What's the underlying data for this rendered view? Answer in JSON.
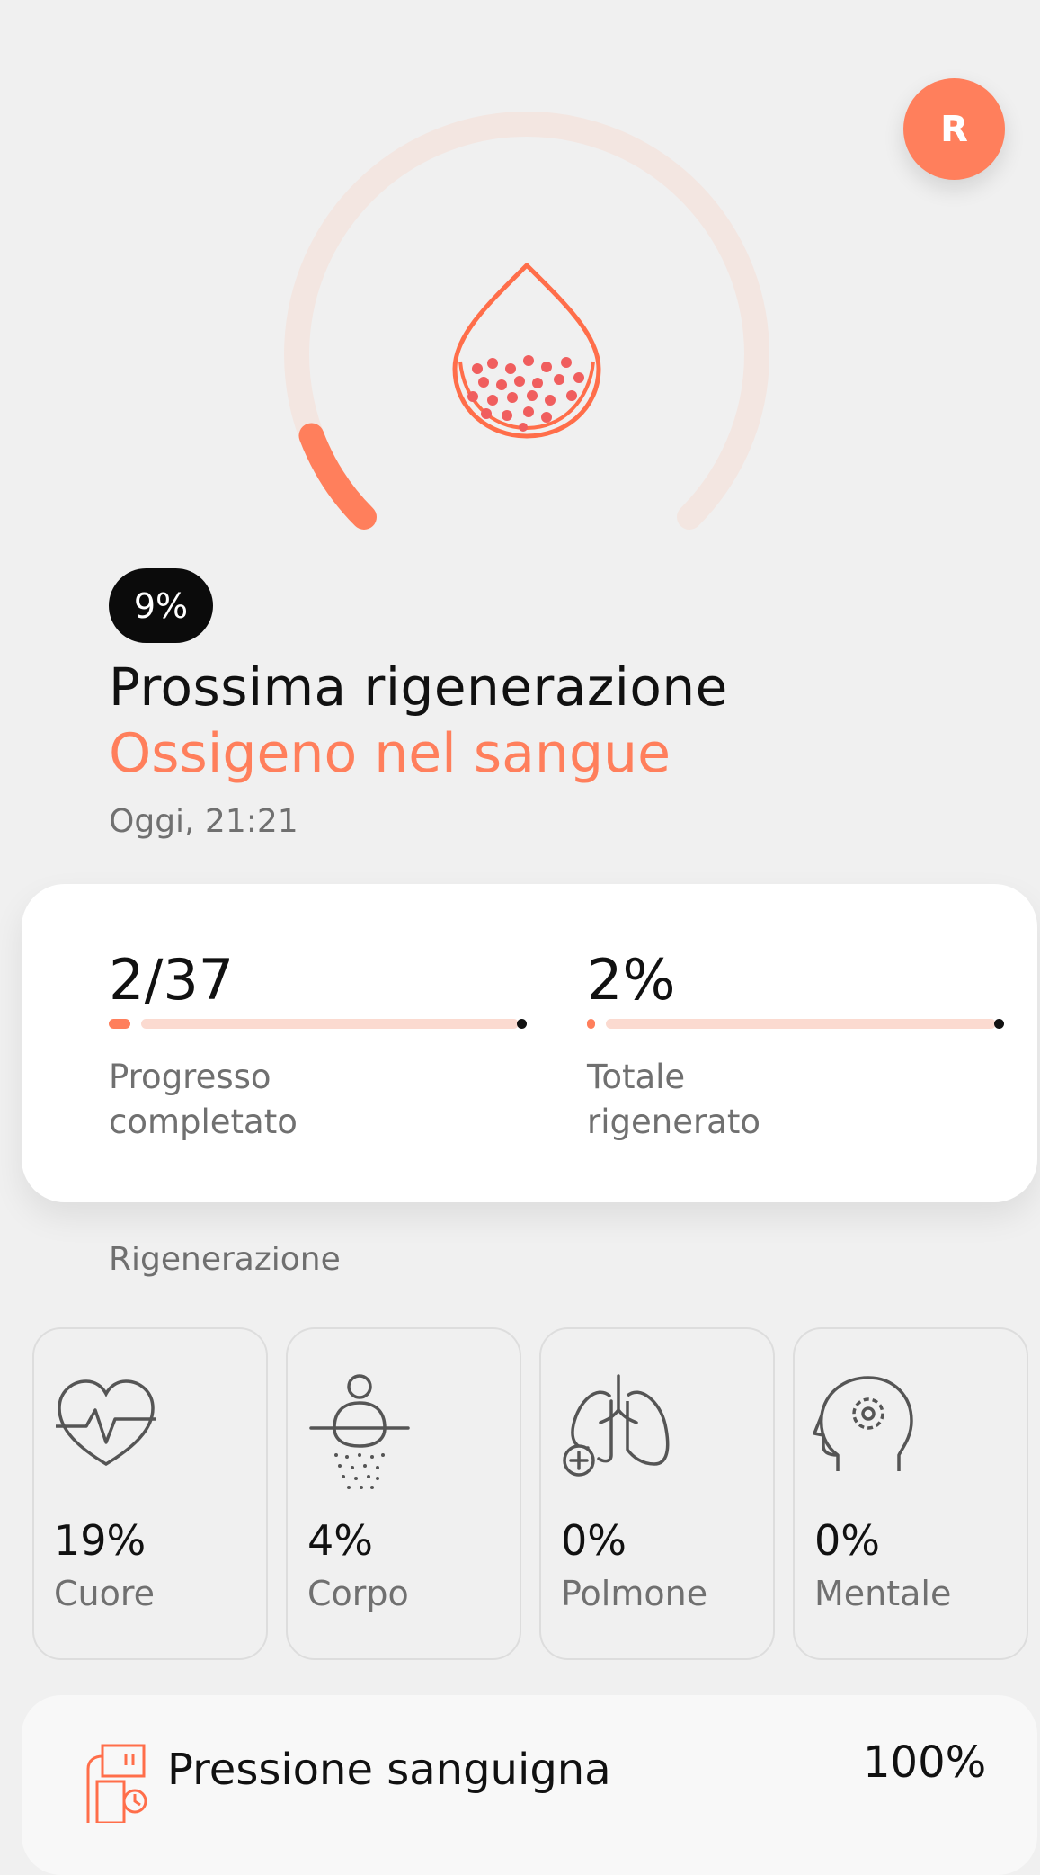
{
  "avatar": {
    "initial": "R"
  },
  "hero": {
    "progress_percent": 9,
    "progress_badge": "9%",
    "title": "Prossima rigenerazione",
    "subtitle": "Ossigeno nel sangue",
    "timestamp": "Oggi, 21:21",
    "icon": "blood-drop-icon"
  },
  "stats": [
    {
      "value": "2/37",
      "label": "Progresso completato",
      "fraction": 0.054
    },
    {
      "value": "2%",
      "label": "Totale rigenerato",
      "fraction": 0.02
    }
  ],
  "section": {
    "title": "Rigenerazione"
  },
  "categories": [
    {
      "icon": "heart-icon",
      "value": "19%",
      "label": "Cuore"
    },
    {
      "icon": "body-shower-icon",
      "value": "4%",
      "label": "Corpo"
    },
    {
      "icon": "lungs-icon",
      "value": "0%",
      "label": "Polmone"
    },
    {
      "icon": "head-gear-icon",
      "value": "0%",
      "label": "Mentale"
    }
  ],
  "bottom_item": {
    "icon": "blood-pressure-icon",
    "title": "Pressione sanguigna",
    "value": "100%"
  },
  "colors": {
    "accent": "#ff7f5c",
    "track": "#f3e6e1",
    "bar_track": "#fbdad0",
    "dark": "#0b0b0b"
  }
}
